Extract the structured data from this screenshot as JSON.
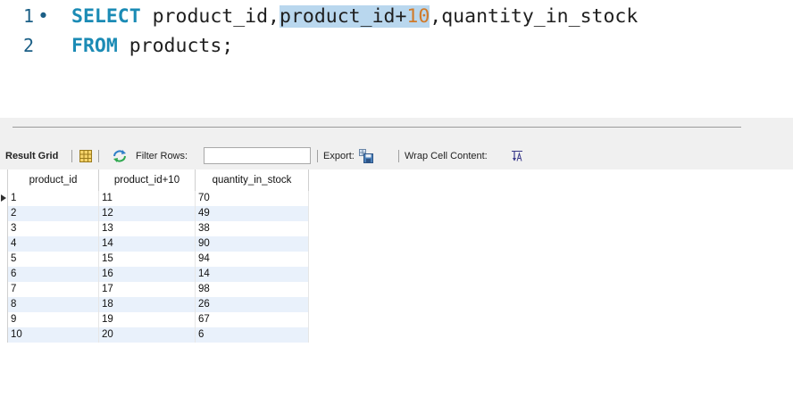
{
  "editor": {
    "line1_number": "1",
    "line1_marker": "•",
    "line2_number": "2",
    "line1": {
      "kw_select": "SELECT",
      "part1": " product_id,",
      "selected_part": "product_id+",
      "selected_num": "10",
      "part2": ",quantity_in_stock"
    },
    "line2": {
      "kw_from": "FROM",
      "part1": " products;"
    }
  },
  "toolbar": {
    "result_grid_label": "Result Grid",
    "filter_rows_label": "Filter Rows:",
    "filter_rows_value": "",
    "export_label": "Export:",
    "wrap_cell_content_label": "Wrap Cell Content:"
  },
  "grid": {
    "columns": [
      "product_id",
      "product_id+10",
      "quantity_in_stock"
    ],
    "rows": [
      [
        "1",
        "11",
        "70"
      ],
      [
        "2",
        "12",
        "49"
      ],
      [
        "3",
        "13",
        "38"
      ],
      [
        "4",
        "14",
        "90"
      ],
      [
        "5",
        "15",
        "94"
      ],
      [
        "6",
        "16",
        "14"
      ],
      [
        "7",
        "17",
        "98"
      ],
      [
        "8",
        "18",
        "26"
      ],
      [
        "9",
        "19",
        "67"
      ],
      [
        "10",
        "20",
        "6"
      ]
    ]
  },
  "icons": {
    "grid_icon": "grid-view-icon",
    "refresh_icon": "refresh-arrows-icon",
    "export_icon": "export-disk-icon",
    "wrap_icon": "wrap-text-icon"
  }
}
